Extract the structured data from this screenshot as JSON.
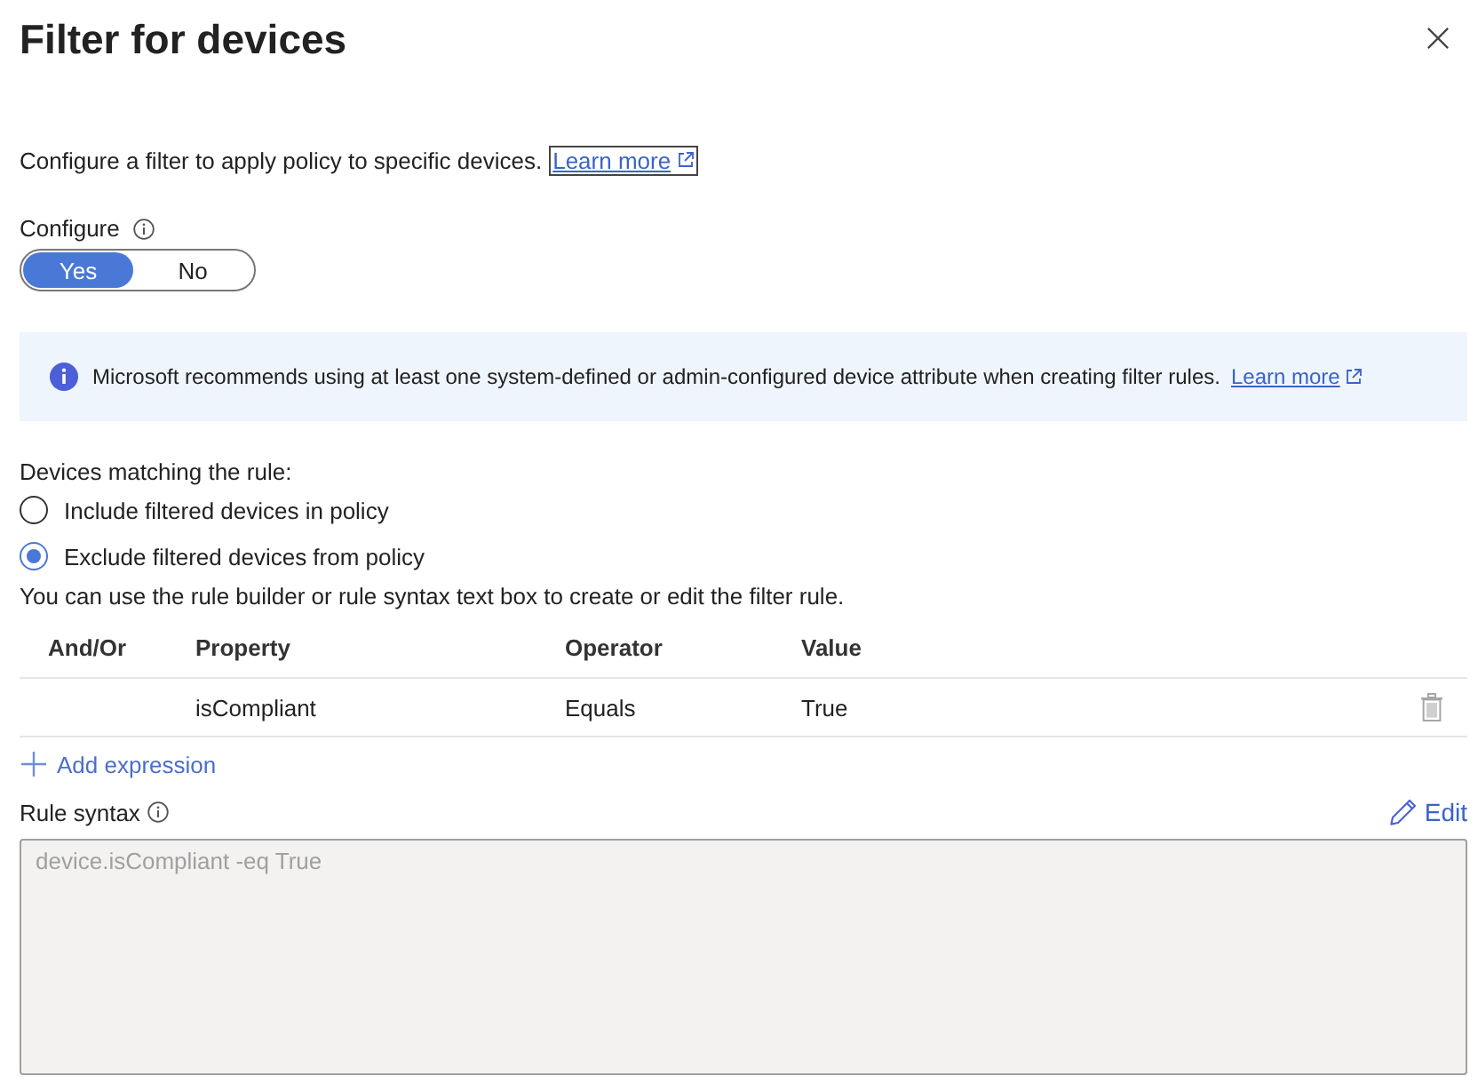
{
  "panel": {
    "title": "Filter for devices"
  },
  "description": {
    "text": "Configure a filter to apply policy to specific devices.",
    "link": {
      "label": "Learn more",
      "focused": true
    }
  },
  "configure": {
    "label": "Configure",
    "options": [
      {
        "label": "Yes",
        "selected": true
      },
      {
        "label": "No",
        "selected": false
      }
    ]
  },
  "info_bar": {
    "text": "Microsoft recommends using at least one system-defined or admin-configured device attribute when creating filter rules.",
    "link": {
      "label": "Learn more",
      "focused": false
    }
  },
  "matching": {
    "label": "Devices matching the rule:",
    "options": [
      {
        "label": "Include filtered devices in policy",
        "selected": false
      },
      {
        "label": "Exclude filtered devices from policy",
        "selected": true
      }
    ]
  },
  "builder_hint": "You can use the rule builder or rule syntax text box to create or edit the filter rule.",
  "rules_table": {
    "columns": [
      "And/Or",
      "Property",
      "Operator",
      "Value"
    ],
    "rows": [
      {
        "property": "isCompliant",
        "operator": "Equals",
        "value": "True"
      }
    ]
  },
  "add_expression": "Add expression",
  "rule_syntax": {
    "label": "Rule syntax",
    "edit": "Edit",
    "value": "device.isCompliant -eq True",
    "disabled": true
  }
}
